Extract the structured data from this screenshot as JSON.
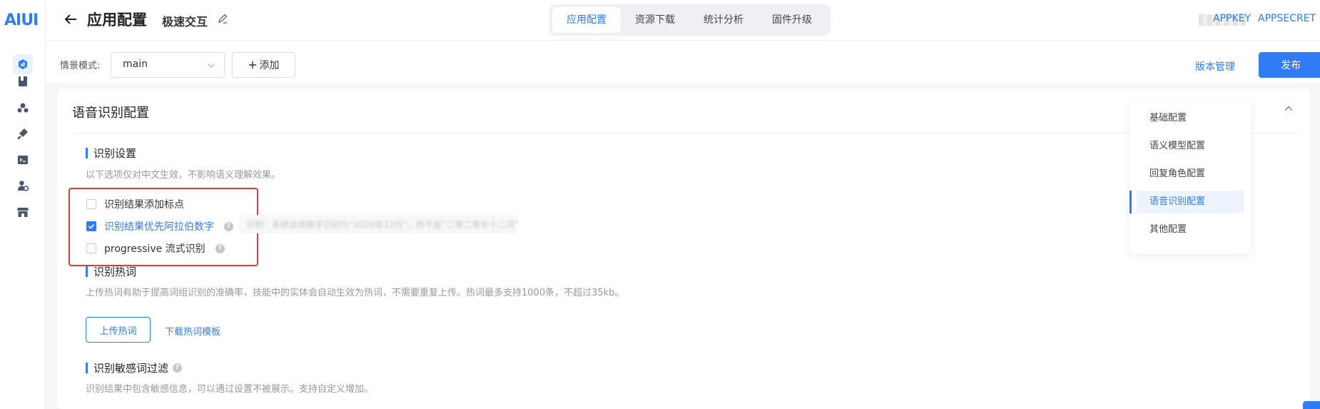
{
  "logo": "AIUI",
  "nav_icons": [
    "app-icon",
    "book-icon",
    "skill-icon",
    "plugin-icon",
    "terminal-icon",
    "user-settings-icon",
    "store-icon"
  ],
  "header": {
    "title": "应用配置",
    "subtitle": "极速交互",
    "tabs": [
      {
        "label": "应用配置",
        "active": true
      },
      {
        "label": "资源下载",
        "active": false
      },
      {
        "label": "统计分析",
        "active": false
      },
      {
        "label": "固件升级",
        "active": false
      }
    ],
    "appkey": "APPKEY",
    "appsecret": "APPSECRET"
  },
  "toolbar": {
    "mode_label": "情景模式:",
    "mode_value": "main",
    "add_label": "添加",
    "version_label": "版本管理",
    "publish_label": "发布"
  },
  "card": {
    "title": "语音识别配置",
    "sections": {
      "recog": {
        "title": "识别设置",
        "desc": "以下选项仅对中文生效，不影响语义理解效果。",
        "options": [
          {
            "label": "识别结果添加标点",
            "checked": false
          },
          {
            "label": "识别结果优先阿拉伯数字",
            "checked": true
          },
          {
            "label": "progressive 流式识别",
            "checked": false
          }
        ]
      },
      "hotword": {
        "title": "识别热词",
        "desc": "上传热词有助于提高词组识别的准确率，技能中的实体会自动生效为热词，不需要重复上传。热词最多支持1000条，不超过35kb。",
        "upload_label": "上传热词",
        "template_label": "下载热词模板"
      },
      "sensitive": {
        "title": "识别敏感词过滤",
        "desc": "识别结果中包含敏感信息，可以通过设置不被展示。支持自定义增加。"
      }
    }
  },
  "anchor_nav": [
    {
      "label": "基础配置",
      "active": false
    },
    {
      "label": "语义模型配置",
      "active": false
    },
    {
      "label": "回复角色配置",
      "active": false
    },
    {
      "label": "语音识别配置",
      "active": true
    },
    {
      "label": "其他配置",
      "active": false
    }
  ],
  "colors": {
    "accent": "#2f7cf6",
    "highlight_box": "#e53935"
  }
}
